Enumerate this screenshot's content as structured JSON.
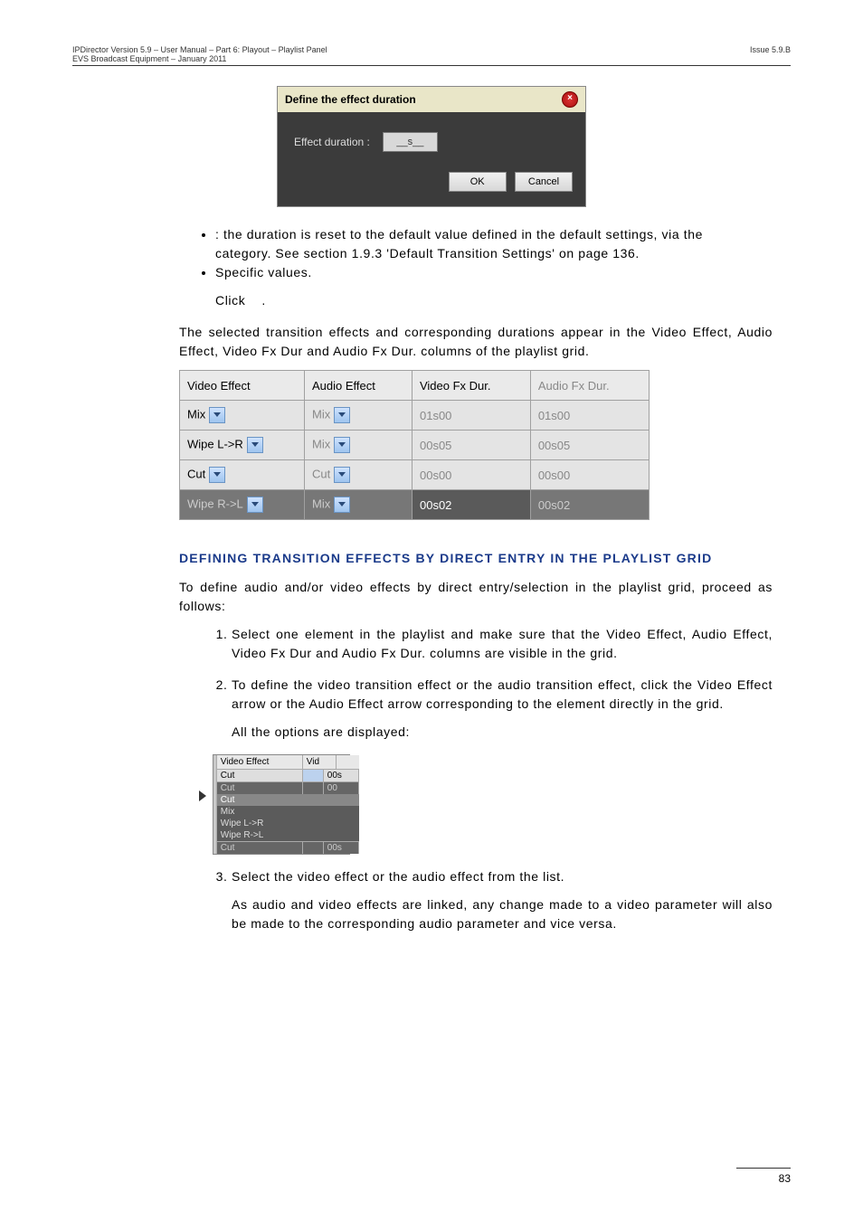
{
  "header": {
    "line1": "IPDirector Version 5.9 – User Manual – Part 6: Playout – Playlist Panel",
    "line2": "EVS Broadcast Equipment – January 2011",
    "issue": "Issue 5.9.B"
  },
  "dialog": {
    "title": "Define the effect duration",
    "label": "Effect duration :",
    "value": "__s__",
    "ok": "OK",
    "cancel": "Cancel"
  },
  "bullets": {
    "b1_tail": ": the duration is reset to the default value defined in the default settings, via the",
    "b1_cont": "category. See section 1.9.3 'Default Transition Settings' on page 136.",
    "b2": "Specific values."
  },
  "click_line": "Click",
  "click_end": ".",
  "para_after": "The selected transition effects and corresponding durations appear in the Video Effect, Audio Effect, Video Fx Dur and Audio Fx Dur. columns of the playlist grid.",
  "table": {
    "headers": [
      "Video Effect",
      "Audio Effect",
      "Video Fx Dur.",
      "Audio Fx Dur."
    ],
    "rows": [
      {
        "ve": "Mix",
        "ae": "Mix",
        "vd": "01s00",
        "ad": "01s00",
        "sel": false
      },
      {
        "ve": "Wipe L->R",
        "ae": "Mix",
        "vd": "00s05",
        "ad": "00s05",
        "sel": false
      },
      {
        "ve": "Cut",
        "ae": "Cut",
        "vd": "00s00",
        "ad": "00s00",
        "sel": false
      },
      {
        "ve": "Wipe R->L",
        "ae": "Mix",
        "vd": "00s02",
        "ad": "00s02",
        "sel": true
      }
    ]
  },
  "section_title": "DEFINING TRANSITION EFFECTS BY DIRECT ENTRY IN THE PLAYLIST GRID",
  "s_para": "To define audio and/or video effects by direct entry/selection in the playlist grid, proceed as follows:",
  "steps": {
    "s1": "Select one element in the playlist and make sure that the Video Effect, Audio Effect, Video Fx Dur and Audio Fx Dur. columns are visible in the grid.",
    "s2": "To define the video transition effect or the audio transition effect, click the Video Effect arrow or the Audio Effect arrow corresponding to the element directly in the grid.",
    "s2b": "All the options are displayed:",
    "s3": "Select the video effect or the audio effect from the list.",
    "s3b": "As audio and video effects are linked, any change made to a video parameter will also be made to the corresponding audio parameter and vice versa."
  },
  "small_grid": {
    "h1": "Video Effect",
    "h2": "Vid",
    "r1": {
      "a": "Cut",
      "b": "00s"
    },
    "r2": {
      "a": "Cut",
      "b": "00"
    },
    "dd": [
      "Cut",
      "Mix",
      "Wipe L->R",
      "Wipe R->L"
    ],
    "r3": {
      "a": "Cut",
      "b": "00s"
    }
  },
  "footer_page": "83"
}
